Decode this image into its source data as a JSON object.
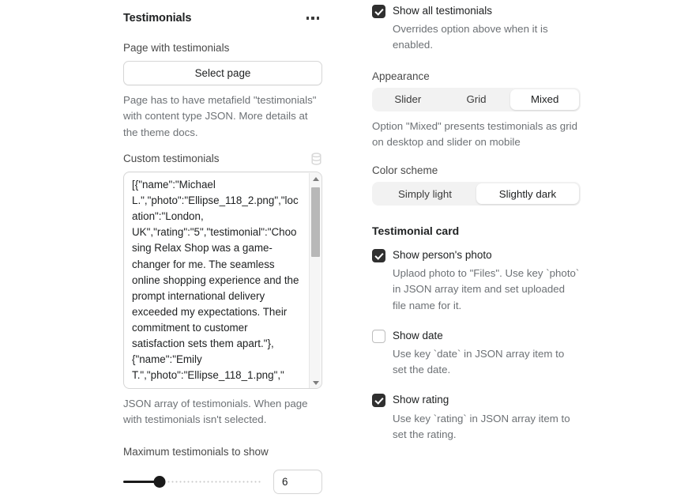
{
  "panel": {
    "title": "Testimonials",
    "menu_icon": "kebab-menu-icon"
  },
  "left": {
    "page_field_label": "Page with testimonials",
    "select_page_button": "Select page",
    "page_help": "Page has to have metafield \"testimonials\" with content type JSON. More details at the theme docs.",
    "custom_label": "Custom testimonials",
    "metafield_icon": "database-icon",
    "custom_value": "[{\"name\":\"Michael L.\",\"photo\":\"Ellipse_118_2.png\",\"location\":\"London, UK\",\"rating\":\"5\",\"testimonial\":\"Choosing Relax Shop was a game-changer for me. The seamless online shopping experience and the prompt international delivery exceeded my expectations. Their commitment to customer satisfaction sets them apart.\"},{\"name\":\"Emily T.\",\"photo\":\"Ellipse_118_1.png\",\"",
    "custom_help": "JSON array of testimonials. When page with testimonials isn't selected.",
    "max_label": "Maximum testimonials to show",
    "max_value": "6"
  },
  "right": {
    "show_all": {
      "label": "Show all testimonials",
      "help": "Overrides option above when it is enabled.",
      "checked": true
    },
    "appearance": {
      "label": "Appearance",
      "options": [
        "Slider",
        "Grid",
        "Mixed"
      ],
      "selected": "Mixed",
      "help": "Option \"Mixed\" presents testimonials as grid on desktop and slider on mobile"
    },
    "color_scheme": {
      "label": "Color scheme",
      "options": [
        "Simply light",
        "Slightly dark"
      ],
      "selected": "Slightly dark"
    },
    "card_section_title": "Testimonial card",
    "show_photo": {
      "label": "Show person's photo",
      "help": "Uplaod photo to \"Files\". Use key `photo` in JSON array item and set uploaded file name for it.",
      "checked": true
    },
    "show_date": {
      "label": "Show date",
      "help": "Use key `date` in JSON array item to set the date.",
      "checked": false
    },
    "show_rating": {
      "label": "Show rating",
      "help": "Use key `rating` in JSON array item to set the rating.",
      "checked": true
    }
  },
  "colors": {
    "accent": "#303030",
    "text": "#202223",
    "muted": "#6d7175",
    "border": "#d6d6d6",
    "track": "#f2f2f2"
  }
}
